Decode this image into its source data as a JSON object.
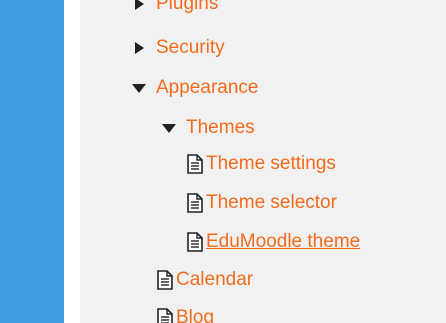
{
  "colors": {
    "left_bar": "#3c9cdc",
    "panel_bg": "#f1f1f1",
    "link": "#f36b1d",
    "icon": "#222222"
  },
  "tree": {
    "items": [
      {
        "label": "Plugins",
        "state": "collapsed",
        "icon": "triangle-right-icon"
      },
      {
        "label": "Security",
        "state": "collapsed",
        "icon": "triangle-right-icon"
      },
      {
        "label": "Appearance",
        "state": "expanded",
        "icon": "triangle-down-icon"
      },
      {
        "label": "Themes",
        "state": "expanded",
        "icon": "triangle-down-icon"
      },
      {
        "label": "Theme settings",
        "icon": "document-icon"
      },
      {
        "label": "Theme selector",
        "icon": "document-icon"
      },
      {
        "label": "EduMoodle theme",
        "icon": "document-icon"
      },
      {
        "label": "Calendar",
        "icon": "document-icon"
      },
      {
        "label": "Blog",
        "icon": "document-icon"
      }
    ]
  }
}
